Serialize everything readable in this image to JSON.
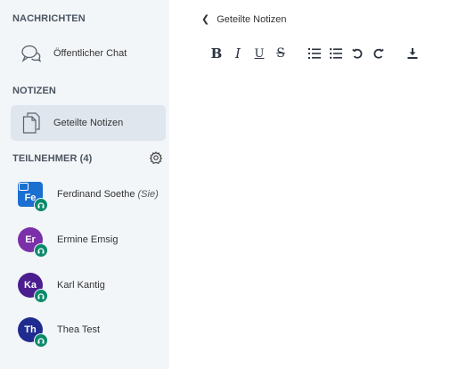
{
  "sidebar": {
    "messages_title": "NACHRICHTEN",
    "public_chat_label": "Öffentlicher Chat",
    "notes_title": "NOTIZEN",
    "shared_notes_label": "Geteilte Notizen",
    "participants_title": "TEILNEHMER (4)",
    "users": [
      {
        "initials": "Fe",
        "name": "Ferdinand Soethe",
        "suffix": "(Sie)",
        "color": "#1a6fd1",
        "presenter": true
      },
      {
        "initials": "Er",
        "name": "Ermine Emsig",
        "suffix": "",
        "color": "#7b2fa8",
        "presenter": false
      },
      {
        "initials": "Ka",
        "name": "Karl Kantig",
        "suffix": "",
        "color": "#4b1d8f",
        "presenter": false
      },
      {
        "initials": "Th",
        "name": "Thea Test",
        "suffix": "",
        "color": "#1f2b8f",
        "presenter": false
      }
    ]
  },
  "main": {
    "back_label": "Geteilte Notizen",
    "toolbar": {
      "bold": "B",
      "italic": "I",
      "underline": "U",
      "strike": "S"
    }
  },
  "colors": {
    "sidebar_bg": "#f3f6f9",
    "active_item_bg": "#dfe6ee",
    "mic_badge": "#0b8a6a"
  }
}
